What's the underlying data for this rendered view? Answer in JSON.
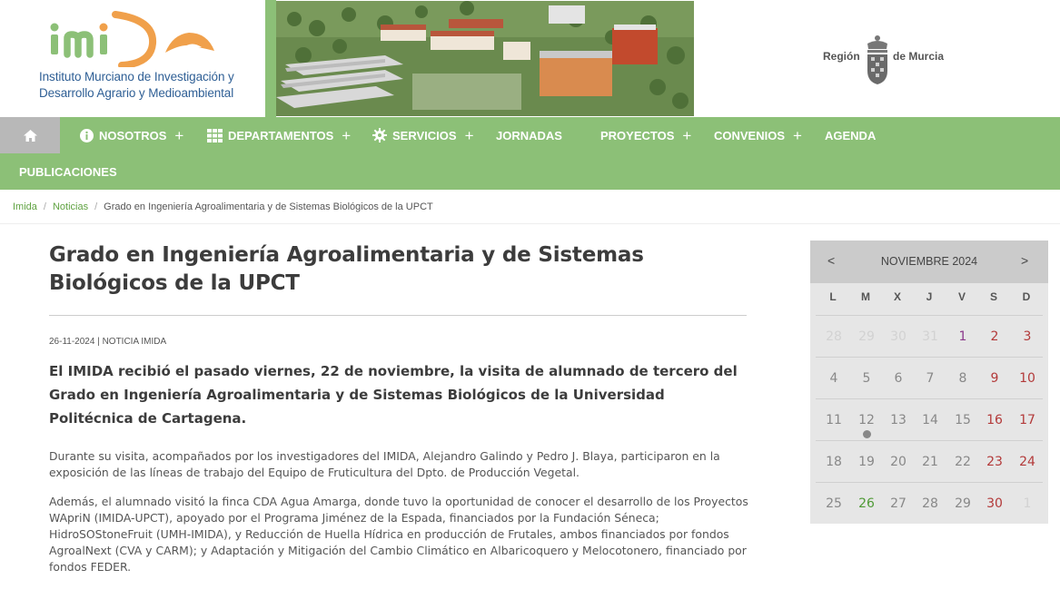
{
  "header": {
    "logo_word": "imida",
    "logo_line1": "Instituto Murciano de Investigación y",
    "logo_line2": "Desarrollo Agrario y Medioambiental",
    "region_left": "Región",
    "region_right": "de Murcia"
  },
  "colors": {
    "nav_green": "#8cc077",
    "link_green": "#5fa241",
    "logo_blue": "#2f5f95",
    "logo_orange": "#f0a04b",
    "calendar_bg": "#e6e6e6"
  },
  "nav": {
    "home_icon": "home-icon",
    "items": [
      {
        "label": "NOSOTROS",
        "icon": "info-icon",
        "plus": "+"
      },
      {
        "label": "DEPARTAMENTOS",
        "icon": "grid-icon",
        "plus": "+"
      },
      {
        "label": "SERVICIOS",
        "icon": "gear-icon",
        "plus": "+"
      },
      {
        "label": "JORNADAS"
      },
      {
        "label": "PROYECTOS",
        "plus": "+"
      },
      {
        "label": "CONVENIOS",
        "plus": "+"
      },
      {
        "label": "AGENDA"
      },
      {
        "label": "PUBLICACIONES"
      }
    ]
  },
  "breadcrumb": {
    "items": [
      "Imida",
      "Noticias"
    ],
    "current": "Grado en Ingeniería Agroalimentaria y de Sistemas Biológicos de la UPCT",
    "separator": "/"
  },
  "article": {
    "title": "Grado en Ingeniería Agroalimentaria y de Sistemas Biológicos de la UPCT",
    "meta": "26-11-2024 | NOTICIA IMIDA",
    "lead": "El IMIDA recibió el pasado viernes, 22 de noviembre, la visita de alumnado de tercero del Grado en Ingeniería Agroalimentaria y de Sistemas Biológicos de la Universidad Politécnica de Cartagena.",
    "p1": "Durante su visita, acompañados por los investigadores del IMIDA, Alejandro Galindo y Pedro J. Blaya, participaron en la exposición de las líneas de trabajo del Equipo de Fruticultura del Dpto. de Producción Vegetal.",
    "p2": "Además, el alumnado visitó la finca CDA Agua Amarga, donde tuvo la oportunidad de conocer el desarrollo de los Proyectos WApriN (IMIDA-UPCT), apoyado por el Programa Jiménez de la Espada, financiados por la Fundación Séneca; HidroSOStoneFruit (UMH-IMIDA), y Reducción de Huella Hídrica en producción de Frutales, ambos financiados por fondos AgroalNext (CVA y CARM); y Adaptación y Mitigación del Cambio Climático en Albaricoquero y Melocotonero, financiado por fondos FEDER."
  },
  "calendar": {
    "prev": "<",
    "next": ">",
    "month": "NOVIEMBRE 2024",
    "weekdays": [
      "L",
      "M",
      "X",
      "J",
      "V",
      "S",
      "D"
    ],
    "weeks": [
      [
        {
          "d": "28",
          "t": "other"
        },
        {
          "d": "29",
          "t": "other"
        },
        {
          "d": "30",
          "t": "other"
        },
        {
          "d": "31",
          "t": "other"
        },
        {
          "d": "1",
          "t": "ev"
        },
        {
          "d": "2",
          "t": "we"
        },
        {
          "d": "3",
          "t": "we"
        }
      ],
      [
        {
          "d": "4"
        },
        {
          "d": "5"
        },
        {
          "d": "6"
        },
        {
          "d": "7"
        },
        {
          "d": "8"
        },
        {
          "d": "9",
          "t": "we"
        },
        {
          "d": "10",
          "t": "we"
        }
      ],
      [
        {
          "d": "11"
        },
        {
          "d": "12",
          "dot": true
        },
        {
          "d": "13"
        },
        {
          "d": "14"
        },
        {
          "d": "15"
        },
        {
          "d": "16",
          "t": "we"
        },
        {
          "d": "17",
          "t": "we"
        }
      ],
      [
        {
          "d": "18"
        },
        {
          "d": "19"
        },
        {
          "d": "20"
        },
        {
          "d": "21"
        },
        {
          "d": "22"
        },
        {
          "d": "23",
          "t": "we"
        },
        {
          "d": "24",
          "t": "we"
        }
      ],
      [
        {
          "d": "25"
        },
        {
          "d": "26",
          "t": "today"
        },
        {
          "d": "27"
        },
        {
          "d": "28"
        },
        {
          "d": "29"
        },
        {
          "d": "30",
          "t": "we"
        },
        {
          "d": "1",
          "t": "other"
        }
      ]
    ]
  }
}
